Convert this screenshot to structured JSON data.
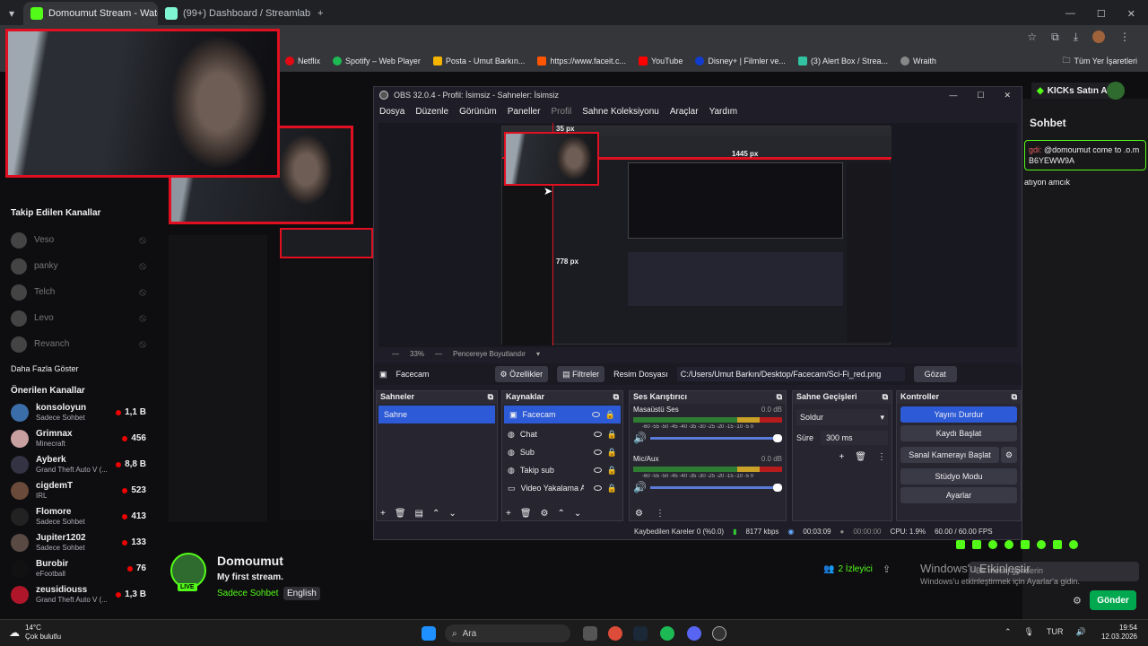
{
  "browser": {
    "tabs": [
      {
        "label": "Domoumut Stream - Watch Liv",
        "color": "#53fc18",
        "active": true
      },
      {
        "label": "(99+) Dashboard / Streamlabs",
        "color": "#80f5d2",
        "active": false
      }
    ],
    "bookmarks": [
      {
        "label": "Netflix",
        "color": "#e50914"
      },
      {
        "label": "Spotify – Web Player",
        "color": "#1db954"
      },
      {
        "label": "Posta - Umut Barkın...",
        "color": "#f4b400"
      },
      {
        "label": "https://www.faceit.c...",
        "color": "#ff5500"
      },
      {
        "label": "YouTube",
        "color": "#ff0000"
      },
      {
        "label": "Disney+ | Filmler ve...",
        "color": "#113ccf"
      },
      {
        "label": "(3) Alert Box / Strea...",
        "color": "#31c3a2"
      },
      {
        "label": "Wraith",
        "color": "#888888"
      }
    ],
    "all_bookmarks": "Tüm Yer İşaretleri"
  },
  "sidebar": {
    "followed_title": "Takip Edilen Kanallar",
    "followed": [
      "Veso",
      "panky",
      "Telch",
      "Levo",
      "Revanch"
    ],
    "show_more": "Daha Fazla Göster",
    "recommended_title": "Önerilen Kanallar",
    "recommended": [
      {
        "name": "konsoloyun",
        "sub": "Sadece Sohbet",
        "viewers": "1,1 B"
      },
      {
        "name": "Grimnax",
        "sub": "Minecraft",
        "viewers": "456"
      },
      {
        "name": "Ayberk",
        "sub": "Grand Theft Auto V (...",
        "viewers": "8,8 B"
      },
      {
        "name": "cigdemT",
        "sub": "IRL",
        "viewers": "523"
      },
      {
        "name": "Flomore",
        "sub": "Sadece Sohbet",
        "viewers": "413"
      },
      {
        "name": "Jupiter1202",
        "sub": "Sadece Sohbet",
        "viewers": "133"
      },
      {
        "name": "Burobir",
        "sub": "eFootball",
        "viewers": "76"
      },
      {
        "name": "zeusidiouss",
        "sub": "Grand Theft Auto V (...",
        "viewers": "1,3 B"
      }
    ]
  },
  "stream": {
    "channel": "Domoumut",
    "title": "My first stream.",
    "category": "Sadece Sohbet",
    "language": "English",
    "live_badge": "LIVE",
    "viewers": "2 İzleyici"
  },
  "chat": {
    "buy_kicks": "KICKs Satın Al",
    "title": "Sohbet",
    "msg1": "@domoumut come to .o.m B6YEWW9A",
    "msg1_user": "gdi:",
    "msg2": "atıyon amcık",
    "send": "Gönder",
    "placeholder": "Bir mesaj gönderin"
  },
  "windows_activation": {
    "line1": "Windows'u Etkinleştir",
    "line2": "Windows'u etkinleştirmek için Ayarlar'a gidin."
  },
  "obs": {
    "title": "OBS 32.0.4 - Profil: İsimsiz - Sahneler: İsimsiz",
    "menu": [
      "Dosya",
      "Düzenle",
      "Görünüm",
      "Paneller",
      "Profil",
      "Sahne Koleksiyonu",
      "Araçlar",
      "Yardım"
    ],
    "preview_zoom": "33%",
    "fit_label": "Pencereye Boyutlandır",
    "measure_top": "35 px",
    "measure_right": "1445 px",
    "measure_left": "778 px",
    "source_label": "Facecam",
    "properties": "Özellikler",
    "filters": "Filtreler",
    "image_file_label": "Resim Dosyası",
    "image_file_path": "C:/Users/Umut Barkın/Desktop/Facecam/Sci-Fi_red.png",
    "browse": "Gözat",
    "scenes_title": "Sahneler",
    "scenes": [
      "Sahne"
    ],
    "sources_title": "Kaynaklar",
    "sources": [
      "Facecam",
      "Chat",
      "Sub",
      "Takip sub",
      "Video Yakalama A"
    ],
    "mixer_title": "Ses Karıştırıcı",
    "mixer": [
      {
        "name": "Masaüstü Ses",
        "db": "0.0 dB"
      },
      {
        "name": "Mic/Aux",
        "db": "0.0 dB"
      }
    ],
    "mixer_scale": "-60 -55 -50 -45 -40 -35 -30 -25 -20 -15 -10 -5 0",
    "transitions_title": "Sahne Geçişleri",
    "transition": "Soldur",
    "duration_label": "Süre",
    "duration": "300 ms",
    "controls_title": "Kontroller",
    "controls": [
      "Yayını Durdur",
      "Kaydı Başlat",
      "Sanal Kamerayı Başlat",
      "Stüdyo Modu",
      "Ayarlar"
    ],
    "status": {
      "dropped": "Kaybedilen Kareler 0 (%0.0)",
      "bitrate": "8177 kbps",
      "stream_time": "00:03:09",
      "rec_time": "00:00:00",
      "cpu": "CPU: 1.9%",
      "fps": "60.00 / 60.00 FPS"
    }
  },
  "taskbar": {
    "weather_temp": "14°C",
    "weather_desc": "Çok bulutlu",
    "search": "Ara",
    "lang": "TUR",
    "time": "19:54",
    "date": "12.03.2026"
  }
}
